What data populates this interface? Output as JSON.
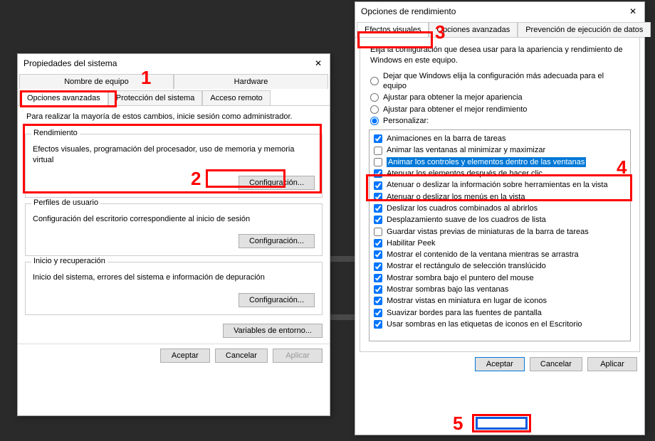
{
  "annotations": {
    "n1": "1",
    "n2": "2",
    "n3": "3",
    "n4": "4",
    "n5": "5"
  },
  "sysprops": {
    "title": "Propiedades del sistema",
    "tabs_top": [
      "Nombre de equipo",
      "Hardware"
    ],
    "tabs_bottom": [
      "Opciones avanzadas",
      "Protección del sistema",
      "Acceso remoto"
    ],
    "intro": "Para realizar la mayoría de estos cambios, inicie sesión como administrador.",
    "perf": {
      "legend": "Rendimiento",
      "text": "Efectos visuales, programación del procesador, uso de memoria y memoria virtual",
      "config": "Configuración..."
    },
    "profiles": {
      "legend": "Perfiles de usuario",
      "text": "Configuración del escritorio correspondiente al inicio de sesión",
      "config": "Configuración..."
    },
    "startup": {
      "legend": "Inicio y recuperación",
      "text": "Inicio del sistema, errores del sistema e información de depuración",
      "config": "Configuración..."
    },
    "envvars": "Variables de entorno...",
    "ok": "Aceptar",
    "cancel": "Cancelar",
    "apply": "Aplicar"
  },
  "perfopt": {
    "title": "Opciones de rendimiento",
    "tabs": [
      "Efectos visuales",
      "Opciones avanzadas",
      "Prevención de ejecución de datos"
    ],
    "intro": "Elija la configuración que desea usar para la apariencia y rendimiento de Windows en este equipo.",
    "radios": {
      "r1": "Dejar que Windows elija la configuración más adecuada para el equipo",
      "r2": "Ajustar para obtener la mejor apariencia",
      "r3": "Ajustar para obtener el mejor rendimiento",
      "r4": "Personalizar:"
    },
    "items": [
      {
        "label": "Animaciones en la barra de tareas",
        "checked": true
      },
      {
        "label": "Animar las ventanas al minimizar y maximizar",
        "checked": false
      },
      {
        "label": "Animar los controles y elementos dentro de las ventanas",
        "checked": false,
        "selected": true
      },
      {
        "label": "Atenuar los elementos después de hacer clic",
        "checked": true
      },
      {
        "label": "Atenuar o deslizar la información sobre herramientas en la vista",
        "checked": true
      },
      {
        "label": "Atenuar o deslizar los menús en la vista",
        "checked": true
      },
      {
        "label": "Deslizar los cuadros combinados al abrirlos",
        "checked": true
      },
      {
        "label": "Desplazamiento suave de los cuadros de lista",
        "checked": true
      },
      {
        "label": "Guardar vistas previas de miniaturas de la barra de tareas",
        "checked": false
      },
      {
        "label": "Habilitar Peek",
        "checked": true
      },
      {
        "label": "Mostrar el contenido de la ventana mientras se arrastra",
        "checked": true
      },
      {
        "label": "Mostrar el rectángulo de selección translúcido",
        "checked": true
      },
      {
        "label": "Mostrar sombra bajo el puntero del mouse",
        "checked": true
      },
      {
        "label": "Mostrar sombras bajo las ventanas",
        "checked": true
      },
      {
        "label": "Mostrar vistas en miniatura en lugar de iconos",
        "checked": true
      },
      {
        "label": "Suavizar bordes para las fuentes de pantalla",
        "checked": true
      },
      {
        "label": "Usar sombras en las etiquetas de iconos en el Escritorio",
        "checked": true
      }
    ],
    "ok": "Aceptar",
    "cancel": "Cancelar",
    "apply": "Aplicar"
  }
}
